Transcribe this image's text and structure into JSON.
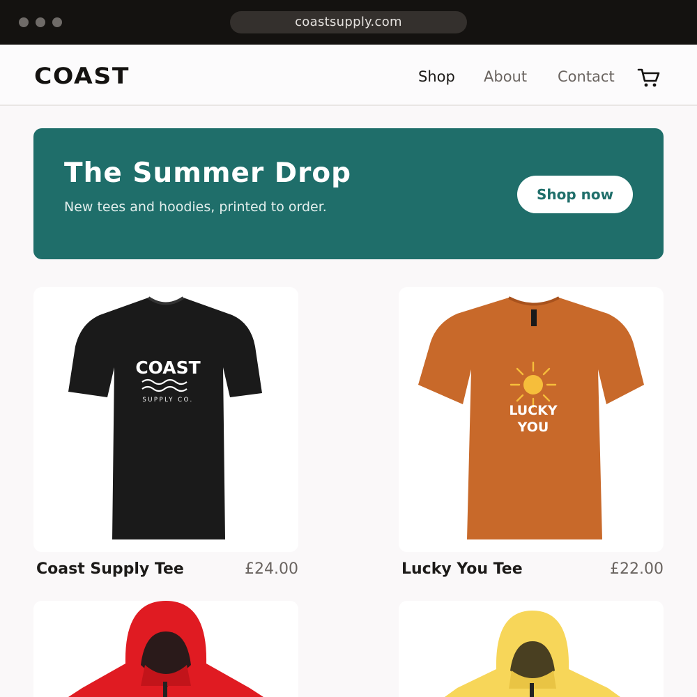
{
  "browser": {
    "url": "coastsupply.com"
  },
  "nav": {
    "logo": "COAST",
    "links": [
      {
        "label": "Shop",
        "active": true
      },
      {
        "label": "About",
        "active": false
      },
      {
        "label": "Contact",
        "active": false
      }
    ],
    "cart_icon": "cart-icon"
  },
  "hero": {
    "title": "The Summer Drop",
    "subtitle": "New tees and hoodies, printed to order.",
    "cta": "Shop now",
    "bg_color": "#1f6e6a"
  },
  "products": [
    {
      "name": "Coast Supply Tee",
      "price": "£24.00",
      "color": "#1a1a1a",
      "print": {
        "line1": "COAST",
        "line2": "SUPPLY CO."
      }
    },
    {
      "name": "Lucky You Tee",
      "price": "£22.00",
      "color": "#c8692a",
      "print": {
        "line1": "LUCKY",
        "line2": "YOU"
      }
    },
    {
      "name": "",
      "price": "",
      "color": "#e01b22"
    },
    {
      "name": "",
      "price": "",
      "color": "#f7d659"
    }
  ]
}
